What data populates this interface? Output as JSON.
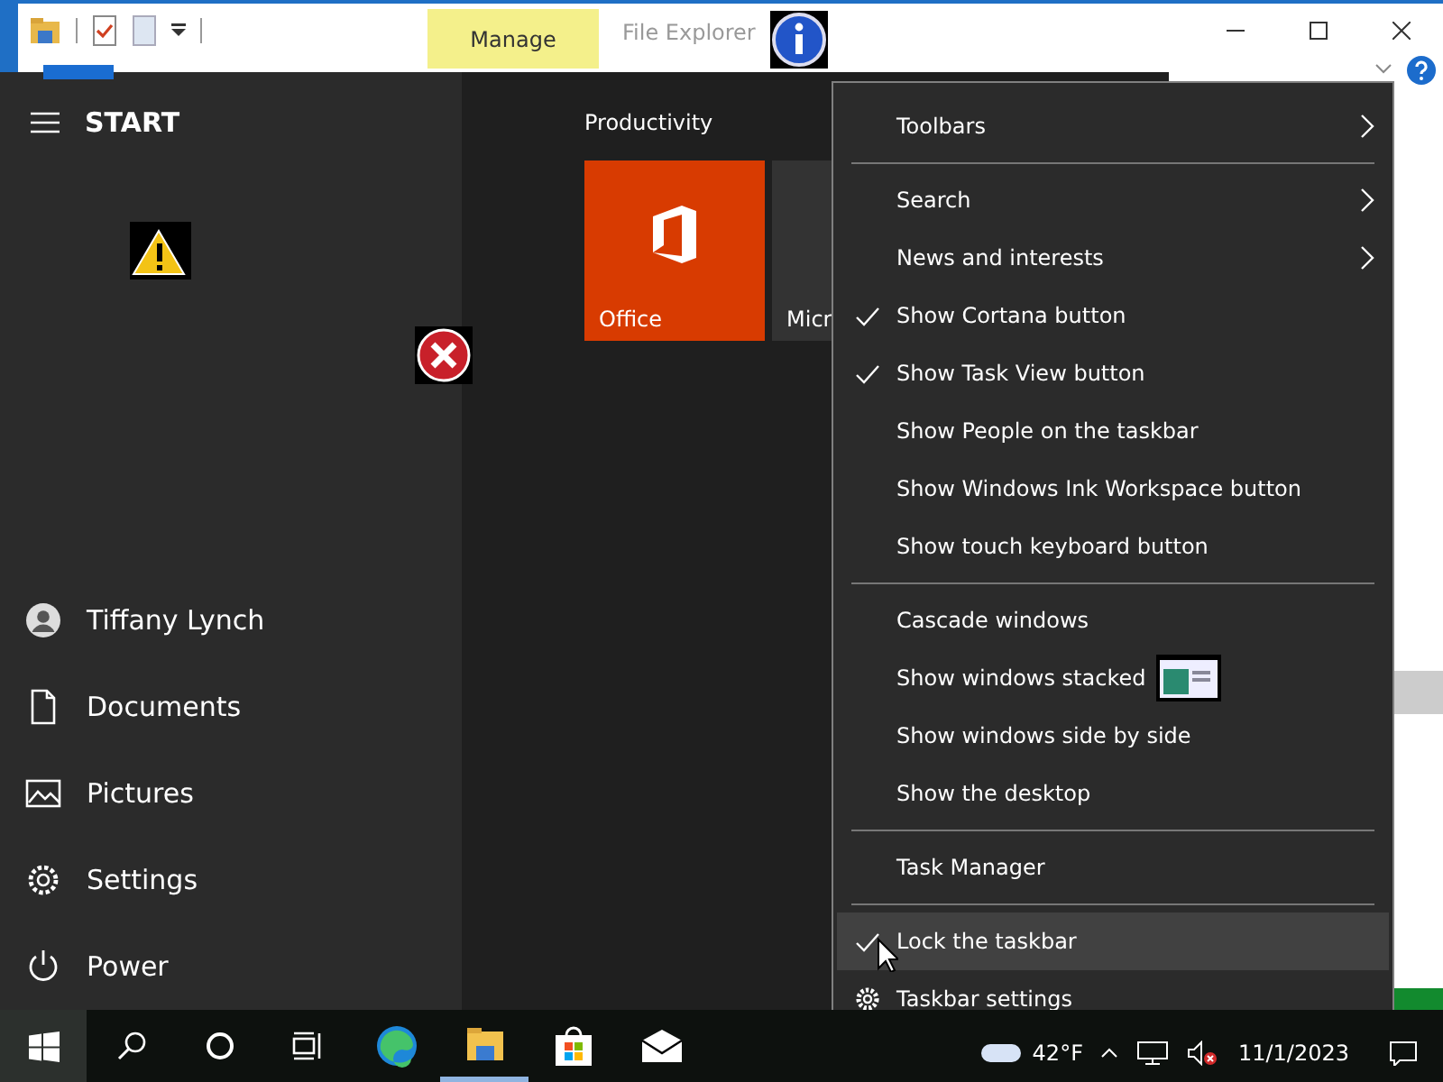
{
  "explorer": {
    "context_tab": "Manage",
    "title": "File Explorer"
  },
  "start_menu": {
    "title": "START",
    "group": "Productivity",
    "tiles": [
      {
        "label": "Office",
        "kind": "office"
      },
      {
        "label": "Micr",
        "kind": "plain"
      }
    ],
    "places": [
      {
        "label": "Tiffany Lynch",
        "kind": "user"
      },
      {
        "label": "Documents",
        "kind": "documents"
      },
      {
        "label": "Pictures",
        "kind": "pictures"
      },
      {
        "label": "Settings",
        "kind": "settings"
      },
      {
        "label": "Power",
        "kind": "power"
      }
    ]
  },
  "context_menu": {
    "groups": [
      [
        {
          "label": "Toolbars",
          "kind": "submenu",
          "checked": false,
          "highlighted": false
        }
      ],
      [
        {
          "label": "Search",
          "kind": "submenu",
          "checked": false,
          "highlighted": false
        },
        {
          "label": "News and interests",
          "kind": "submenu",
          "checked": false,
          "highlighted": false
        },
        {
          "label": "Show Cortana button",
          "kind": "toggle",
          "checked": true,
          "highlighted": false
        },
        {
          "label": "Show Task View button",
          "kind": "toggle",
          "checked": true,
          "highlighted": false
        },
        {
          "label": "Show People on the taskbar",
          "kind": "toggle",
          "checked": false,
          "highlighted": false
        },
        {
          "label": "Show Windows Ink Workspace button",
          "kind": "toggle",
          "checked": false,
          "highlighted": false
        },
        {
          "label": "Show touch keyboard button",
          "kind": "toggle",
          "checked": false,
          "highlighted": false
        }
      ],
      [
        {
          "label": "Cascade windows",
          "kind": "command",
          "checked": false,
          "highlighted": false
        },
        {
          "label": "Show windows stacked",
          "kind": "command",
          "checked": false,
          "highlighted": false
        },
        {
          "label": "Show windows side by side",
          "kind": "command",
          "checked": false,
          "highlighted": false
        },
        {
          "label": "Show the desktop",
          "kind": "command",
          "checked": false,
          "highlighted": false
        }
      ],
      [
        {
          "label": "Task Manager",
          "kind": "command",
          "checked": false,
          "highlighted": false
        }
      ],
      [
        {
          "label": "Lock the taskbar",
          "kind": "toggle",
          "checked": true,
          "highlighted": true
        },
        {
          "label": "Taskbar settings",
          "kind": "settings",
          "checked": false,
          "highlighted": false
        }
      ]
    ]
  },
  "taskbar": {
    "apps": [
      {
        "kind": "search",
        "running": false
      },
      {
        "kind": "cortana",
        "running": false
      },
      {
        "kind": "taskview",
        "running": false
      },
      {
        "kind": "browser",
        "running": false
      },
      {
        "kind": "folder",
        "running": true
      },
      {
        "kind": "store",
        "running": false
      },
      {
        "kind": "mail",
        "running": false
      }
    ],
    "temperature": "42°F",
    "date": "11/1/2023"
  }
}
